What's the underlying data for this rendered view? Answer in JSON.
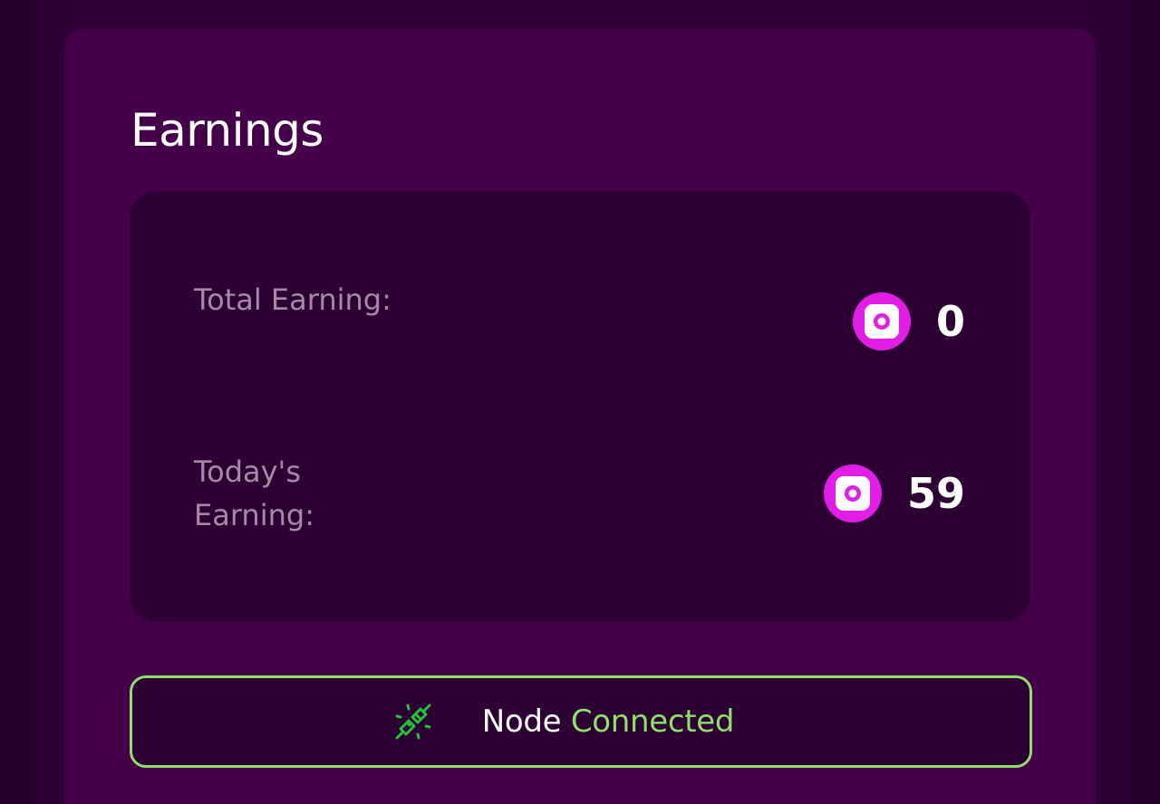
{
  "earnings": {
    "title": "Earnings",
    "total": {
      "label": "Total Earning:",
      "value": "0",
      "icon": "coin-icon"
    },
    "today": {
      "label": "Today's Earning:",
      "value": "59",
      "icon": "coin-icon"
    }
  },
  "node": {
    "icon": "plug-connected-icon",
    "label": "Node",
    "state": "Connected"
  },
  "colors": {
    "background": "#2e0035",
    "panel": "#440048",
    "inner_box": "#2c0032",
    "coin": "#e21ee6",
    "connected": "#8ee06a",
    "label_muted": "#a58aa8"
  }
}
